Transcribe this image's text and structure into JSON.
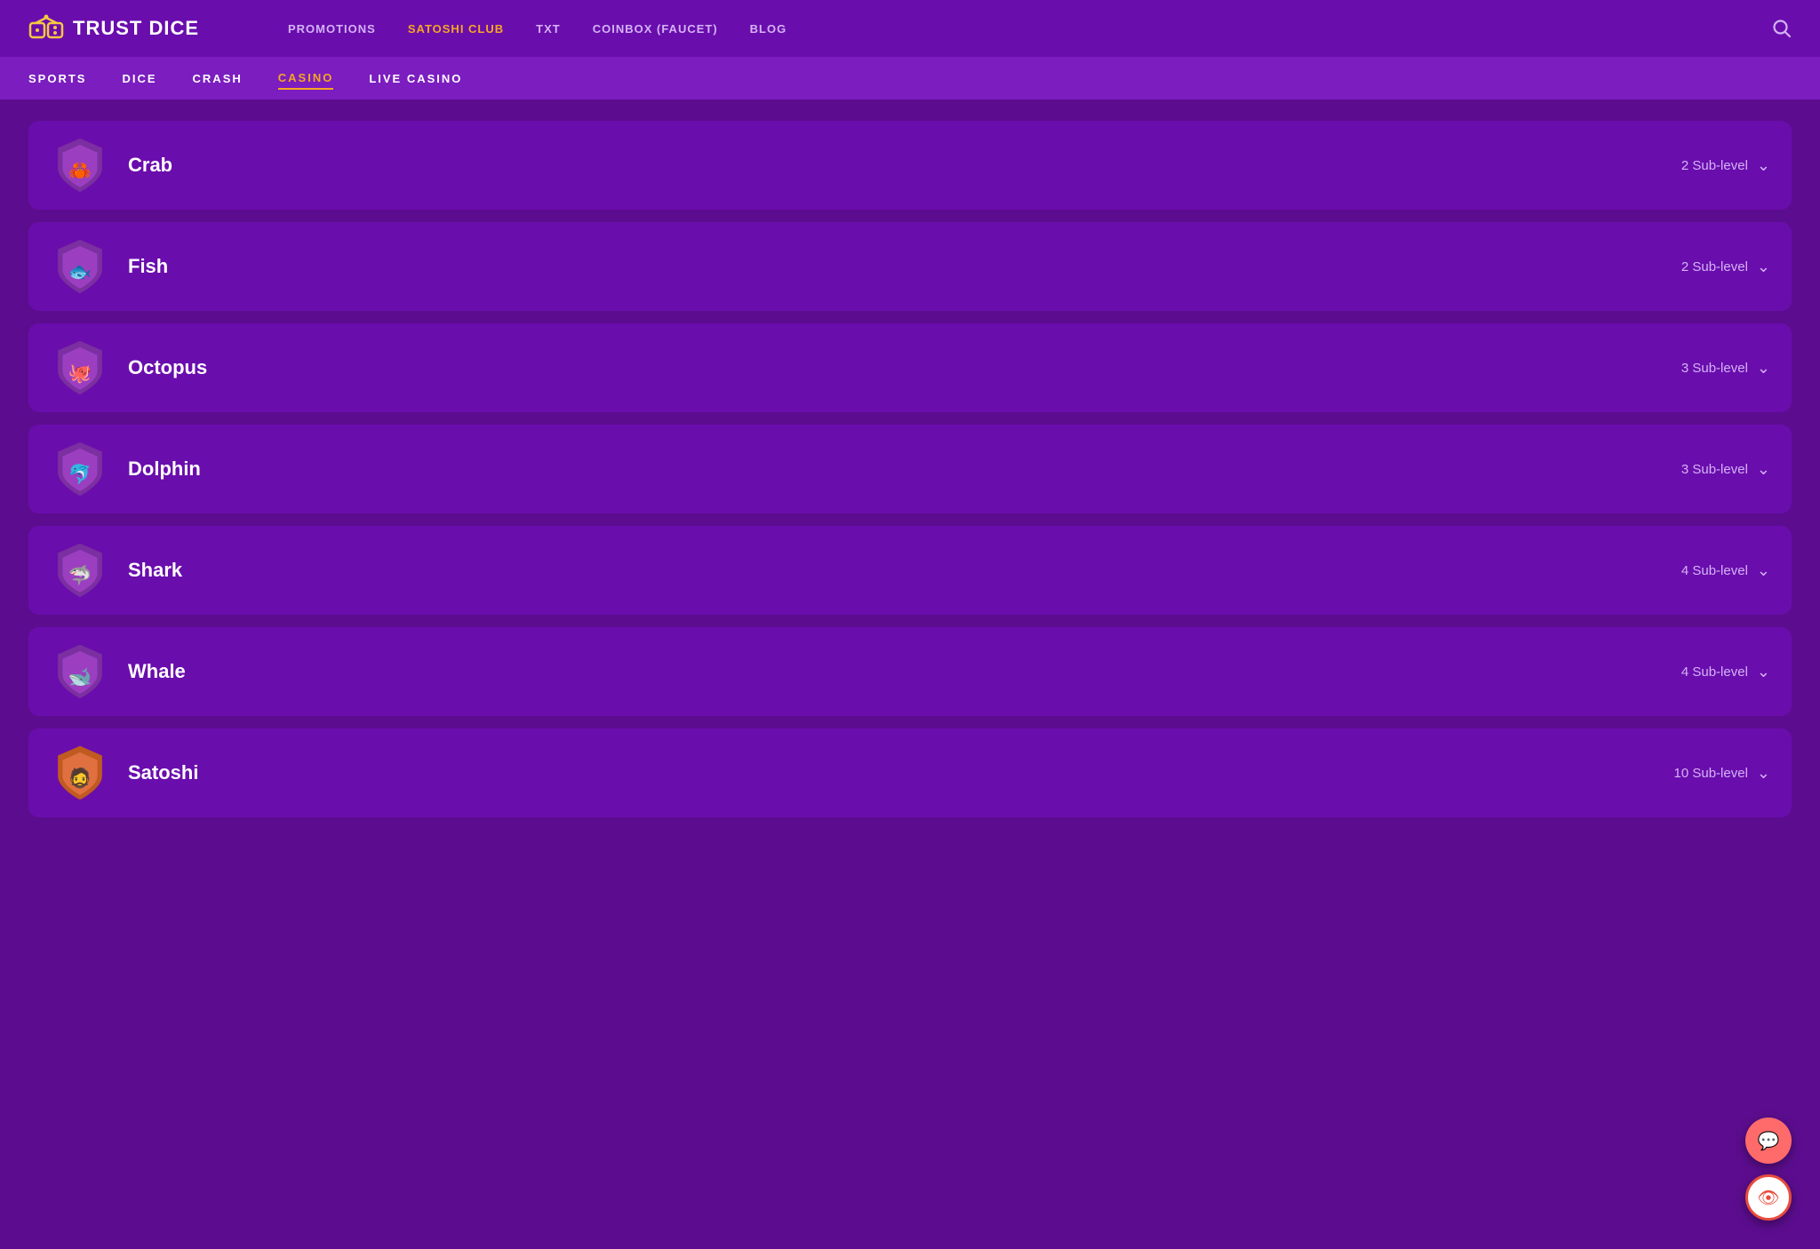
{
  "logo": {
    "text": "TRUST DICE",
    "icon_alt": "trust-dice-logo"
  },
  "nav": {
    "links": [
      {
        "label": "PROMOTIONS",
        "active": false
      },
      {
        "label": "SATOSHI CLUB",
        "active": true
      },
      {
        "label": "TXT",
        "active": false
      },
      {
        "label": "COINBOX (FAUCET)",
        "active": false
      },
      {
        "label": "BLOG",
        "active": false
      }
    ]
  },
  "sub_nav": {
    "links": [
      {
        "label": "SPORTS",
        "active": false
      },
      {
        "label": "DICE",
        "active": false
      },
      {
        "label": "CRASH",
        "active": false
      },
      {
        "label": "CASINO",
        "active": true
      },
      {
        "label": "LIVE CASINO",
        "active": false
      }
    ]
  },
  "levels": [
    {
      "name": "Crab",
      "sub_count": "2 Sub-level",
      "emoji": "🦀",
      "badge_color": "#7b2fa0"
    },
    {
      "name": "Fish",
      "sub_count": "2 Sub-level",
      "emoji": "🐟",
      "badge_color": "#7b2fa0"
    },
    {
      "name": "Octopus",
      "sub_count": "3 Sub-level",
      "emoji": "🐙",
      "badge_color": "#7b2fa0"
    },
    {
      "name": "Dolphin",
      "sub_count": "3 Sub-level",
      "emoji": "🐬",
      "badge_color": "#7b2fa0"
    },
    {
      "name": "Shark",
      "sub_count": "4 Sub-level",
      "emoji": "🦈",
      "badge_color": "#7b2fa0"
    },
    {
      "name": "Whale",
      "sub_count": "4 Sub-level",
      "emoji": "🐋",
      "badge_color": "#7b2fa0"
    },
    {
      "name": "Satoshi",
      "sub_count": "10 Sub-level",
      "emoji": "🧔",
      "badge_color": "#e07040"
    }
  ],
  "fab": {
    "chat_icon": "💬",
    "eye_icon": "👁"
  }
}
